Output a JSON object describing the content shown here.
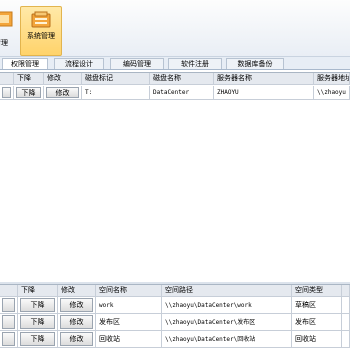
{
  "toolbar": {
    "partial_label": "清理",
    "system_label": "系统管理"
  },
  "tabs": [
    "权限管理",
    "流程设计",
    "编码管理",
    "软件注册",
    "数据库备份"
  ],
  "disk_grid": {
    "headers": [
      "",
      "下降",
      "修改",
      "磁盘标记",
      "磁盘名称",
      "服务器名称",
      "服务器地址"
    ],
    "rows": [
      {
        "b0": "",
        "down": "下降",
        "edit": "修改",
        "mark": "T:",
        "name": "DataCenter",
        "server": "ZHAOYU",
        "addr": "\\\\zhaoyu"
      }
    ]
  },
  "space_grid": {
    "headers": [
      "",
      "下降",
      "修改",
      "空间名称",
      "空间路径",
      "空间类型",
      ""
    ],
    "rows": [
      {
        "b0": "",
        "down": "下降",
        "edit": "修改",
        "name": "work",
        "path": "\\\\zhaoyu\\DataCenter\\work",
        "type": "草稿区",
        "x": ""
      },
      {
        "b0": "",
        "down": "下降",
        "edit": "修改",
        "name": "发布区",
        "path": "\\\\zhaoyu\\DataCenter\\发布区",
        "type": "发布区",
        "x": ""
      },
      {
        "b0": "",
        "down": "下降",
        "edit": "修改",
        "name": "回收站",
        "path": "\\\\zhaoyu\\DataCenter\\回收站",
        "type": "回收站",
        "x": ""
      }
    ]
  }
}
